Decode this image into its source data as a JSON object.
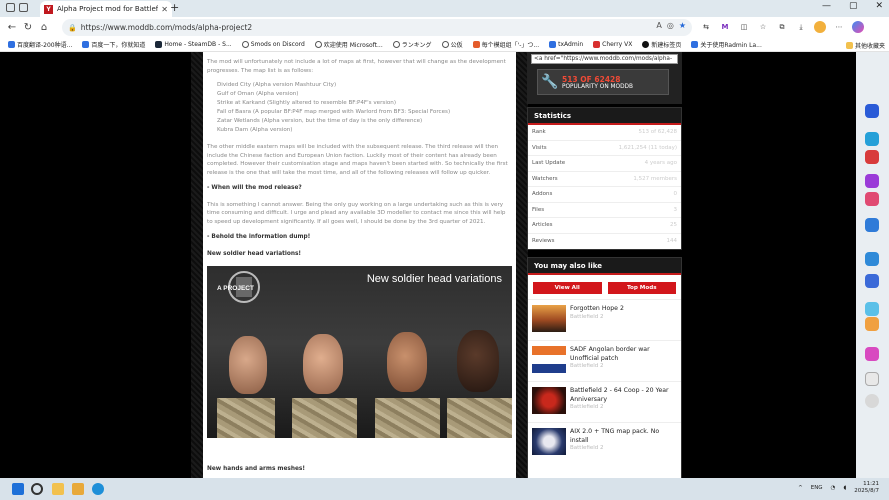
{
  "browser": {
    "tab_title": "Alpha Project mod for Battlefield 2",
    "tab_favicon": "Y",
    "url": "https://www.moddb.com/mods/alpha-project2",
    "bookmarks": [
      "百度翻译-200种语...",
      "百度一下，你就知道",
      "Home - SteamDB - S...",
      "Smods on Discord",
      "欢迎使用 Microsoft...",
      "ランキング",
      "公仮",
      "每个模组组「'-」つ...",
      "txAdmin",
      "Cherry VX",
      "新建标签页",
      "关于使用Radmin La..."
    ],
    "bookmarks_other": "其他收藏夹"
  },
  "article": {
    "intro": "The mod will unfortunately not include a lot of maps at first, however that will change as the development progresses. The map list is as follows:",
    "maps": [
      "Divided City (Alpha version Mashtuur City)",
      "Gulf of Oman (Alpha version)",
      "Strike at Karkand (Slightly altered to resemble BF:P4F's version)",
      "Fall of Basra (A popular BF:P4F map merged with Warlord from BF3: Special Forces)",
      "Zatar Wetlands (Alpha version, but the time of day is the only difference)",
      "Kubra Dam (Alpha version)"
    ],
    "para2": "The other middle eastern maps will be included with the subsequent release. The third release will then include the Chinese faction and European Union faction. Luckily most of their content has already been completed. However their customisation stage and maps haven't been started with. So technically the first release is the one that will take the most time, and all of the following releases will follow up quicker.",
    "q_when": "- When will the mod release?",
    "para3": "This is something I cannot answer. Being the only guy working on a large undertaking such as this is very time consuming and difficult. I urge and plead any available 3D modeller to contact me since this will help to speed up development significantly. If all goes well, I should be done by the 3rd quarter of 2021.",
    "h_dump": "- Behold the information dump!",
    "h_heads": "New soldier head variations!",
    "image_title": "New soldier head variations",
    "image_logo": "A PROJECT",
    "h_hands": "New hands and arms meshes!"
  },
  "sidebar": {
    "embed_code": "<a href=\"https://www.moddb.com/mods/alpha-",
    "popularity_rank": "513 OF 62428",
    "popularity_label": "POPULARITY ON MODDB",
    "stats_title": "Statistics",
    "stats": [
      {
        "label": "Rank",
        "value": "513 of 62,428"
      },
      {
        "label": "Visits",
        "value": "1,621,254 (11 today)"
      },
      {
        "label": "Last Update",
        "value": "4 years ago"
      },
      {
        "label": "Watchers",
        "value": "1,527 members"
      },
      {
        "label": "Addons",
        "value": "0"
      },
      {
        "label": "Files",
        "value": "3"
      },
      {
        "label": "Articles",
        "value": "25"
      },
      {
        "label": "Reviews",
        "value": "144"
      }
    ],
    "also_title": "You may also like",
    "view_all": "View All",
    "top_mods": "Top Mods",
    "mods": [
      {
        "name": "Forgotten Hope 2",
        "game": "Battlefield 2"
      },
      {
        "name": "SADF Angolan border war Unofficial patch",
        "game": "Battlefield 2"
      },
      {
        "name": "Battlefield 2 - 64 Coop - 20 Year Anniversary",
        "game": "Battlefield 2"
      },
      {
        "name": "AIX 2.0 + TNG map pack. No install",
        "game": "Battlefield 2"
      }
    ]
  },
  "taskbar": {
    "lang": "ENG",
    "time": "11:21",
    "date": "2025/8/7"
  }
}
